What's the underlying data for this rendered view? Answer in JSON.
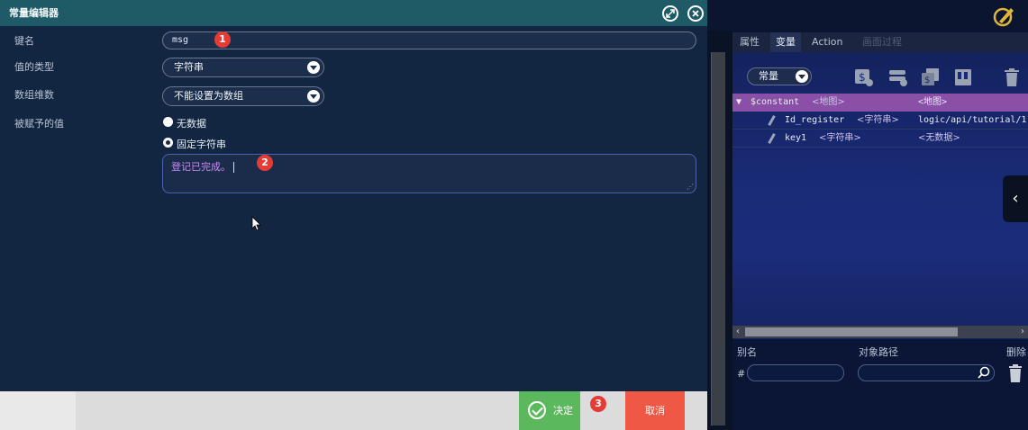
{
  "dialog": {
    "title": "常量编辑器",
    "fields": {
      "key_label": "键名",
      "key_value": "msg",
      "type_label": "值的类型",
      "type_value": "字符串",
      "dim_label": "数组维数",
      "dim_value": "不能设置为数组",
      "assigned_label": "被赋予的值",
      "radio_none": "无数据",
      "radio_fixed": "固定字符串",
      "value_text": "登记已完成。"
    },
    "badges": [
      "1",
      "2",
      "3"
    ],
    "buttons": {
      "ok": "决定",
      "cancel": "取消"
    }
  },
  "right_panel": {
    "tabs": [
      "属性",
      "变量",
      "Action",
      "画面过程"
    ],
    "active_tab": "变量",
    "scope_select": "常量",
    "tree": [
      {
        "name": "$constant",
        "type": "<地图>",
        "value": "<地图>"
      },
      {
        "name": "Id_register",
        "type": "<字符串>",
        "value": "logic/api/tutorial/1"
      },
      {
        "name": "key1",
        "type": "<字符串>",
        "value": "<无数据>"
      }
    ],
    "alias_header": {
      "alias": "别名",
      "path": "对象路径",
      "delete": "删除"
    },
    "alias_hash": "#"
  },
  "colors": {
    "title_bar": "#1f5a67",
    "selected_row": "#8a4fa6",
    "ok": "#5cb85c",
    "cancel": "#ef5845",
    "badge": "#e53b35"
  }
}
